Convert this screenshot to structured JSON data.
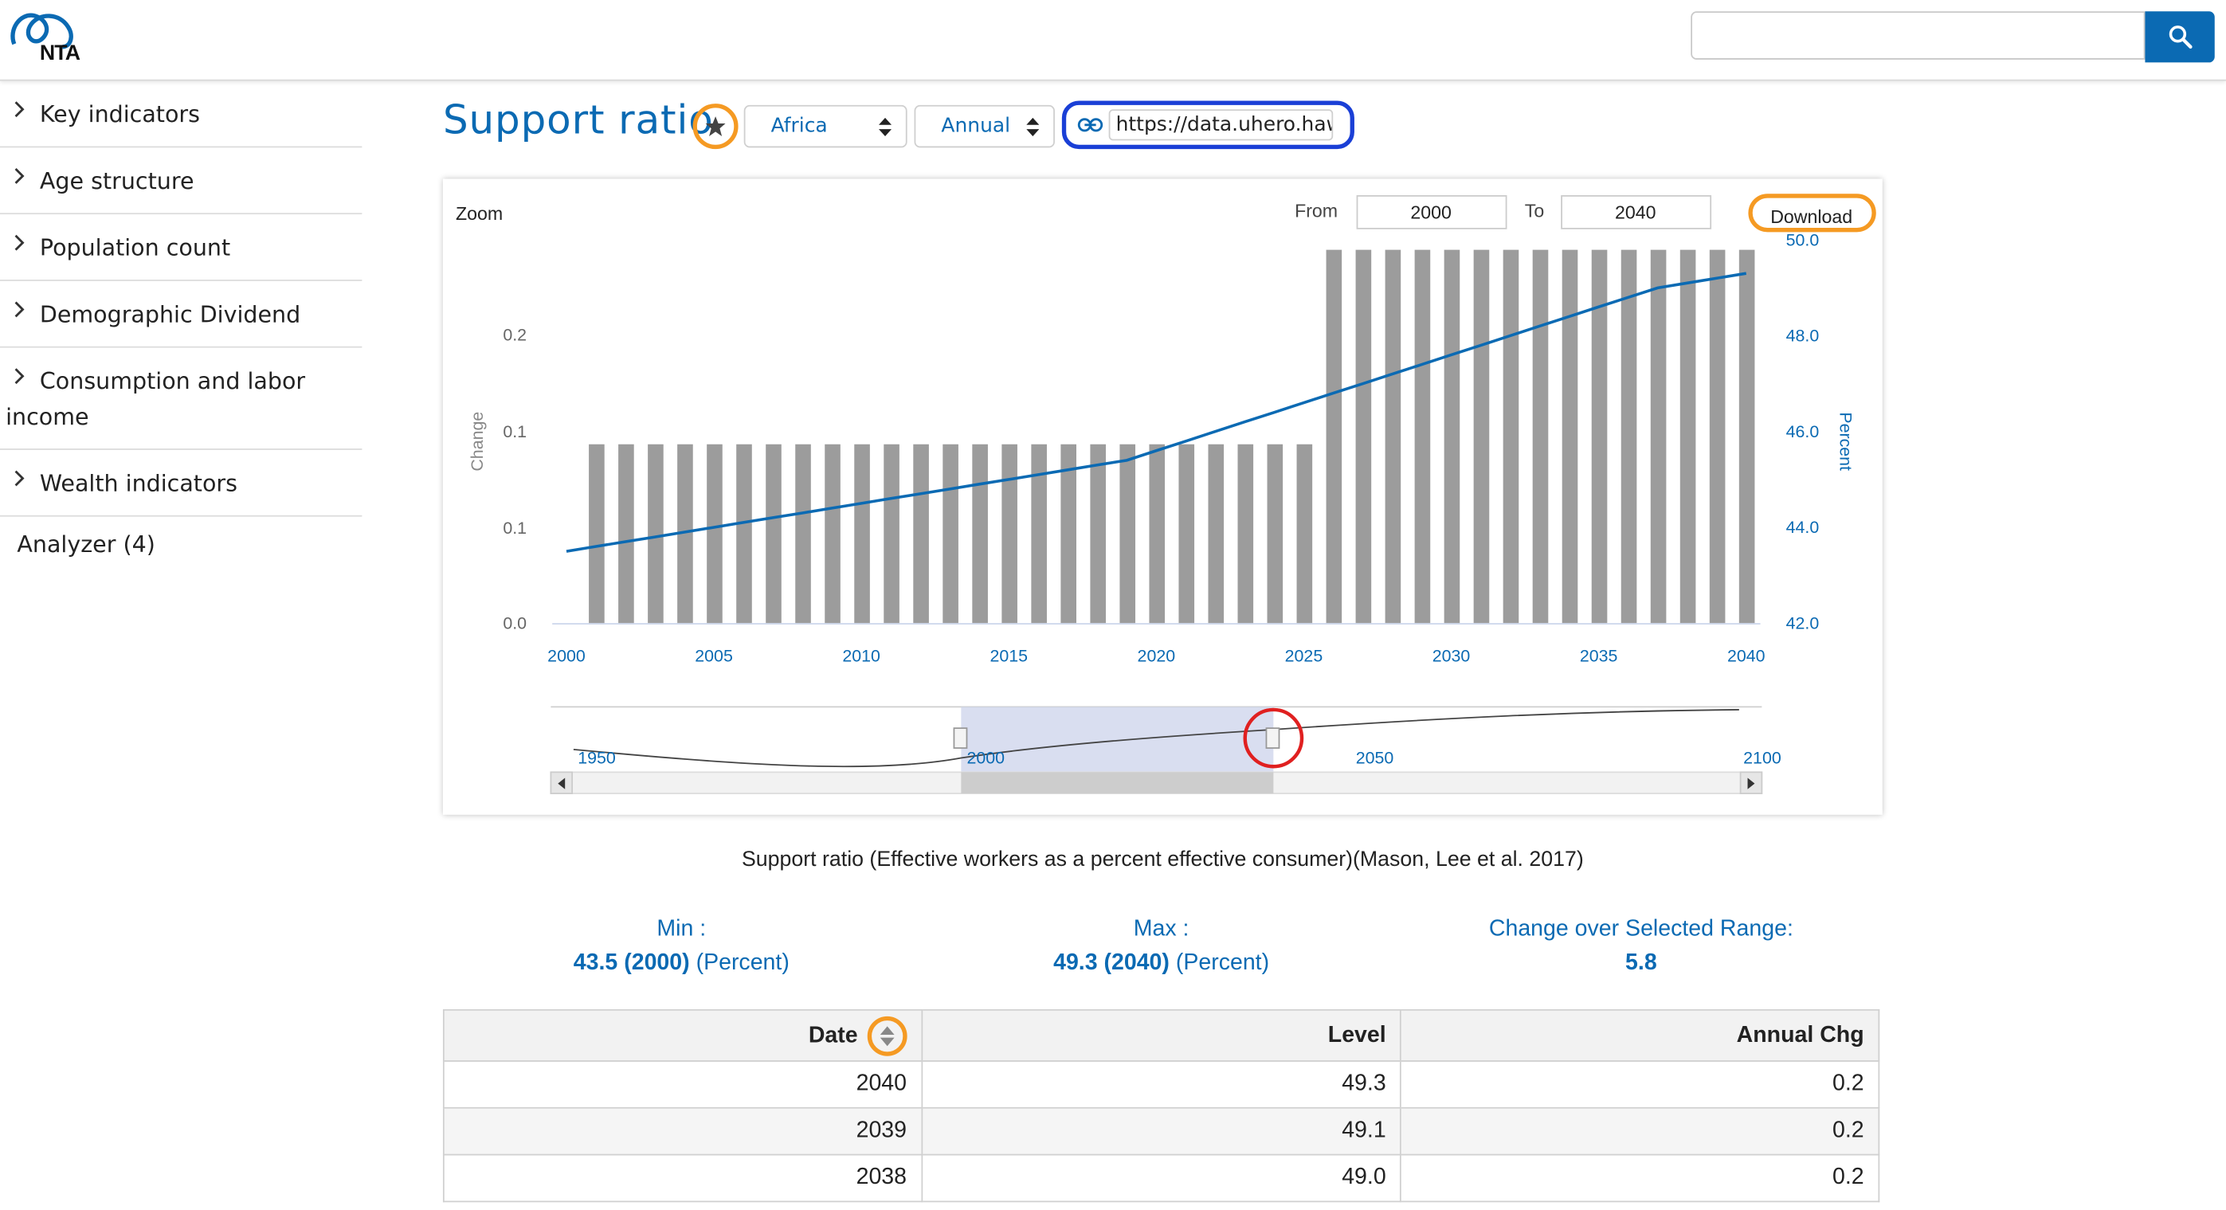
{
  "header": {
    "logo_text": "NTA",
    "search_placeholder": ""
  },
  "sidebar": {
    "items": [
      {
        "label": "Key indicators"
      },
      {
        "label": "Age structure"
      },
      {
        "label": "Population count"
      },
      {
        "label": "Demographic Dividend"
      },
      {
        "label": "Consumption and labor income"
      },
      {
        "label": "Wealth indicators"
      }
    ],
    "analyzer_label": "Analyzer (4)"
  },
  "page": {
    "title": "Support ratio",
    "region_select": "Africa",
    "frequency_select": "Annual",
    "link_url": "https://data.uhero.hawaii.edu"
  },
  "chart": {
    "zoom_label": "Zoom",
    "from_label": "From",
    "from_value": "2000",
    "to_label": "To",
    "to_value": "2040",
    "download_label": "Download",
    "navigator_labels": [
      "1950",
      "2000",
      "2050",
      "2100"
    ]
  },
  "chart_data": {
    "type": "bar+line",
    "x": [
      2000,
      2001,
      2002,
      2003,
      2004,
      2005,
      2006,
      2007,
      2008,
      2009,
      2010,
      2011,
      2012,
      2013,
      2014,
      2015,
      2016,
      2017,
      2018,
      2019,
      2020,
      2021,
      2022,
      2023,
      2024,
      2025,
      2026,
      2027,
      2028,
      2029,
      2030,
      2031,
      2032,
      2033,
      2034,
      2035,
      2036,
      2037,
      2038,
      2039,
      2040
    ],
    "series": [
      {
        "name": "Change",
        "axis": "left",
        "type": "bar",
        "values": [
          null,
          0.1,
          0.1,
          0.1,
          0.1,
          0.1,
          0.1,
          0.1,
          0.1,
          0.1,
          0.1,
          0.1,
          0.1,
          0.1,
          0.1,
          0.1,
          0.1,
          0.1,
          0.1,
          0.1,
          0.1,
          0.1,
          0.1,
          0.1,
          0.1,
          0.1,
          0.2,
          0.2,
          0.2,
          0.2,
          0.2,
          0.2,
          0.2,
          0.2,
          0.2,
          0.2,
          0.2,
          0.2,
          0.2,
          0.2,
          0.2
        ]
      },
      {
        "name": "Percent",
        "axis": "right",
        "type": "line",
        "values": [
          43.5,
          43.6,
          43.7,
          43.8,
          43.9,
          44.0,
          44.1,
          44.2,
          44.3,
          44.4,
          44.5,
          44.6,
          44.7,
          44.8,
          44.9,
          45.0,
          45.1,
          45.2,
          45.3,
          45.4,
          45.6,
          45.8,
          46.0,
          46.2,
          46.4,
          46.6,
          46.8,
          47.0,
          47.2,
          47.4,
          47.6,
          47.8,
          48.0,
          48.2,
          48.4,
          48.6,
          48.8,
          49.0,
          49.1,
          49.2,
          49.3
        ]
      }
    ],
    "xticks": [
      "2000",
      "2005",
      "2010",
      "2015",
      "2020",
      "2025",
      "2030",
      "2035",
      "2040"
    ],
    "yleft_label": "Change",
    "yleft_ticks": [
      "0.0",
      "0.1",
      "0.1",
      "0.2"
    ],
    "yright_label": "Percent",
    "yright_ticks": [
      "42.0",
      "44.0",
      "46.0",
      "48.0",
      "50.0"
    ],
    "yright_lim": [
      42,
      50
    ],
    "navigator_range": [
      1950,
      2100
    ],
    "selected_range": [
      2000,
      2040
    ]
  },
  "summary": {
    "caption": "Support ratio (Effective workers as a percent effective consumer)(Mason, Lee et al. 2017)",
    "min_label": "Min :",
    "min_value": "43.5 (2000)",
    "min_unit": "(Percent)",
    "max_label": "Max :",
    "max_value": "49.3 (2040)",
    "max_unit": "(Percent)",
    "change_label": "Change over Selected Range:",
    "change_value": "5.8"
  },
  "table": {
    "headers": [
      "Date",
      "Level",
      "Annual Chg"
    ],
    "rows": [
      [
        "2040",
        "49.3",
        "0.2"
      ],
      [
        "2039",
        "49.1",
        "0.2"
      ],
      [
        "2038",
        "49.0",
        "0.2"
      ]
    ]
  },
  "colors": {
    "accent": "#0b6ab3",
    "bar": "#9c9c9c",
    "highlight_orange": "#f59a23",
    "highlight_blue": "#1a3fd6",
    "highlight_red": "#e02020"
  }
}
